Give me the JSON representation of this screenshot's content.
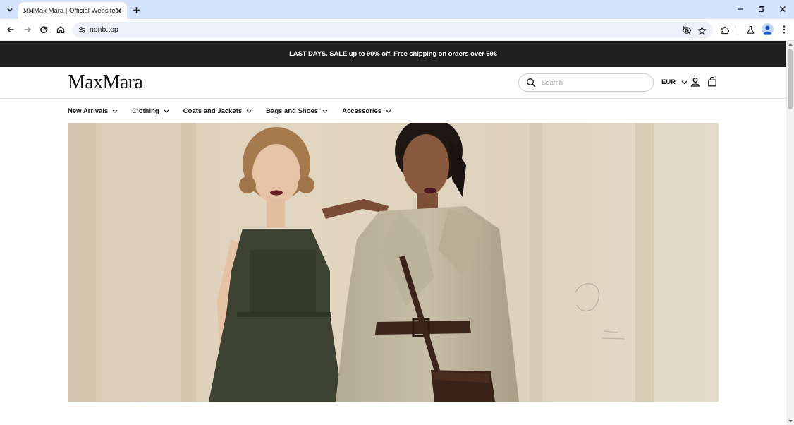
{
  "browser": {
    "tab": {
      "favicon_text": "MM",
      "title": "Max Mara | Official Website"
    },
    "address_bar": {
      "url": "nonb.top"
    },
    "icons": {
      "tab_menu": "chevron-down-icon",
      "tab_close": "close-icon",
      "new_tab": "plus-icon",
      "minimize": "minimize-icon",
      "restore": "restore-icon",
      "close_window": "close-icon",
      "back": "arrow-left-icon",
      "forward": "arrow-right-icon",
      "reload": "reload-icon",
      "home": "home-icon",
      "site_info": "tune-icon",
      "eye_off": "eye-off-icon",
      "bookmark": "star-icon",
      "extensions": "puzzle-icon",
      "labs": "flask-icon",
      "profile": "avatar-icon",
      "menu": "kebab-menu-icon"
    }
  },
  "site": {
    "promo": "LAST DAYS. SALE up to 90% off. Free shipping on orders over 69€",
    "logo": "MaxMara",
    "search": {
      "placeholder": "Search"
    },
    "currency": "EUR",
    "nav": [
      {
        "label": "New Arrivals"
      },
      {
        "label": "Clothing"
      },
      {
        "label": "Coats and Jackets"
      },
      {
        "label": "Bags and Shoes"
      },
      {
        "label": "Accessories"
      }
    ],
    "colors": {
      "promo_bg": "#1e1e1e",
      "chrome_tab_strip": "#d3e3fd",
      "omnibox_bg": "#eef1f8"
    }
  }
}
